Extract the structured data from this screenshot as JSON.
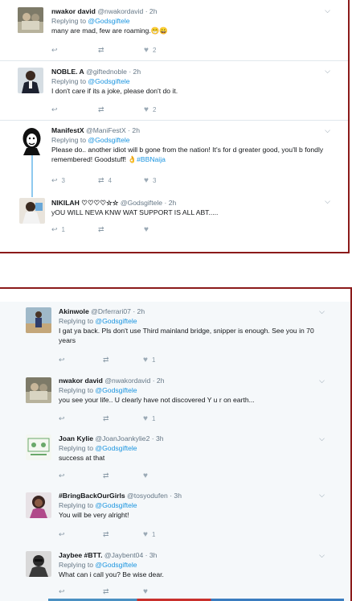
{
  "panel1": {
    "tweets": [
      {
        "name": "nwakor david",
        "handle": "@nwakordavid",
        "time": "· 2h",
        "reply_prefix": "Replying to ",
        "reply_to": "@Godsgiftele",
        "text": "many are mad,  few are roaming.😁😀",
        "replies": "",
        "retweets": "",
        "likes": "2"
      },
      {
        "name": "NOBLE. A",
        "handle": "@giftednoble",
        "time": "· 2h",
        "reply_prefix": "Replying to ",
        "reply_to": "@Godsgiftele",
        "text": "I don't care if its a joke, please don't do it.",
        "replies": "",
        "retweets": "",
        "likes": "2"
      },
      {
        "name": "ManifestX",
        "handle": "@ManiFestX",
        "time": "· 2h",
        "reply_prefix": "Replying to ",
        "reply_to": "@Godsgiftele",
        "text": "Please do.. another idiot will b gone from the nation! It's for d greater good, you'll b fondly remembered! Goodstuff! 👌",
        "hashtag": "#BBNaija",
        "replies": "3",
        "retweets": "4",
        "likes": "3"
      },
      {
        "name": "NIKILAH ♡♡♡♡☆☆",
        "handle": "@Godsgiftele",
        "time": "· 2h",
        "text": "yOU WILL NEVA KNW WAT SUPPORT IS ALL ABT.....",
        "replies": "1",
        "retweets": "",
        "likes": ""
      }
    ]
  },
  "panel2": {
    "tweets": [
      {
        "name": "Akinwole",
        "handle": "@Drferrari07",
        "time": "· 2h",
        "reply_prefix": "Replying to ",
        "reply_to": "@Godsgiftele",
        "text": "I gat ya back. Pls don't use Third mainland bridge, snipper is enough. See you in 70 years",
        "replies": "",
        "retweets": "",
        "likes": "1"
      },
      {
        "name": "nwakor david",
        "handle": "@nwakordavid",
        "time": "· 2h",
        "reply_prefix": "Replying to ",
        "reply_to": "@Godsgiftele",
        "text": "you see your life.. U clearly have not discovered Y u r on earth...",
        "replies": "",
        "retweets": "",
        "likes": "1"
      },
      {
        "name": "Joan Kylie",
        "handle": "@JoanJoankylie2",
        "time": "· 3h",
        "reply_prefix": "Replying to ",
        "reply_to": "@Godsgiftele",
        "text": "success at that",
        "replies": "",
        "retweets": "",
        "likes": ""
      },
      {
        "name": "#BringBackOurGirls",
        "handle": "@tosyodufen",
        "time": "· 3h",
        "reply_prefix": "Replying to ",
        "reply_to": "@Godsgiftele",
        "text": "You will be very alright!",
        "replies": "",
        "retweets": "",
        "likes": "1"
      },
      {
        "name": "Jaybee #BTT.",
        "handle": "@Jaybent04",
        "time": "· 3h",
        "reply_prefix": "Replying to ",
        "reply_to": "@Godsgiftele",
        "text": "What can i call you? Be wise dear.",
        "replies": "",
        "retweets": "",
        "likes": ""
      }
    ]
  },
  "icons": {
    "reply": "reply-icon",
    "retweet": "retweet-icon",
    "like": "heart-icon",
    "more": "chevron-down-icon"
  }
}
